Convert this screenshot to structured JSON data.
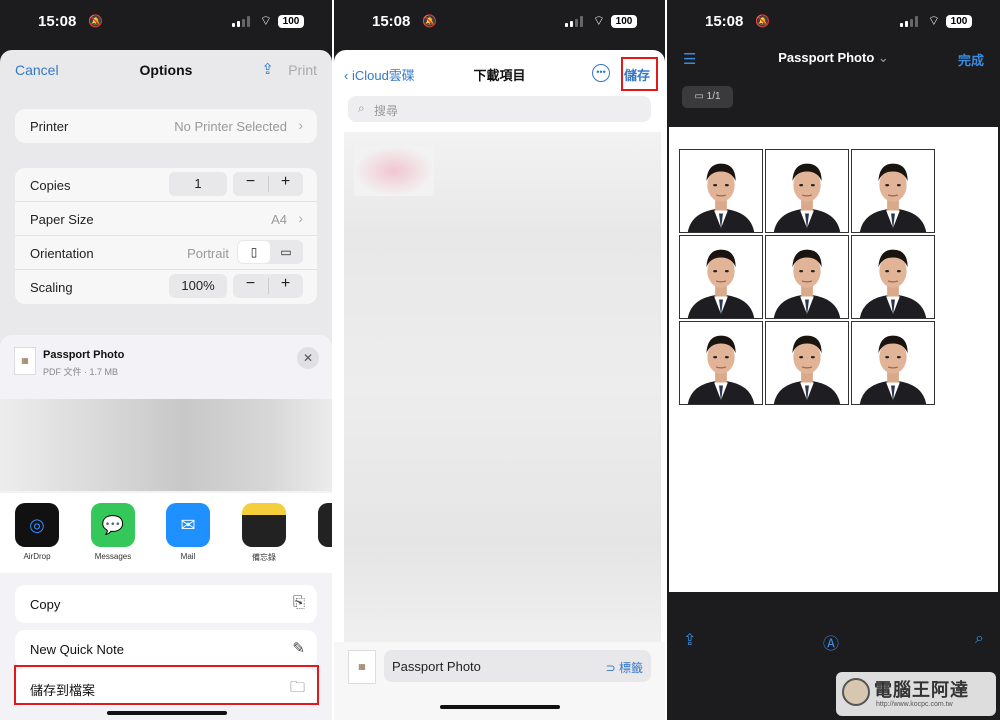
{
  "status": {
    "time": "15:08",
    "battery": "100"
  },
  "panel1": {
    "nav": {
      "cancel": "Cancel",
      "title": "Options",
      "print": "Print"
    },
    "printer": {
      "label": "Printer",
      "value": "No Printer Selected"
    },
    "copies": {
      "label": "Copies",
      "value": "1"
    },
    "paper_size": {
      "label": "Paper Size",
      "value": "A4"
    },
    "orientation": {
      "label": "Orientation",
      "value": "Portrait"
    },
    "scaling": {
      "label": "Scaling",
      "value": "100%"
    },
    "stepper": {
      "minus": "−",
      "plus": "+"
    },
    "file": {
      "name": "Passport Photo",
      "meta": "PDF 文件 · 1.7 MB"
    },
    "apps": [
      {
        "name": "AirDrop",
        "color": "#1d6fd6"
      },
      {
        "name": "Messages",
        "color": "#34c759"
      },
      {
        "name": "Mail",
        "color": "#1e90ff"
      },
      {
        "name": "備忘錄",
        "color": "#f5cf3b"
      }
    ],
    "actions": {
      "copy": "Copy",
      "quick_note": "New Quick Note",
      "save_files": "儲存到檔案"
    }
  },
  "panel2": {
    "nav": {
      "back": "iCloud雲碟",
      "title": "下載項目",
      "save": "儲存"
    },
    "search": {
      "placeholder": "搜尋"
    },
    "footer": {
      "filename": "Passport Photo",
      "tags": "標籤"
    }
  },
  "panel3": {
    "nav": {
      "title": "Passport Photo",
      "done": "完成"
    },
    "page_indicator": "1/1",
    "watermark": {
      "text": "電腦王阿達",
      "url": "http://www.kocpc.com.tw"
    }
  },
  "colors": {
    "accent": "#3478c9",
    "highlight": "#e31818"
  }
}
